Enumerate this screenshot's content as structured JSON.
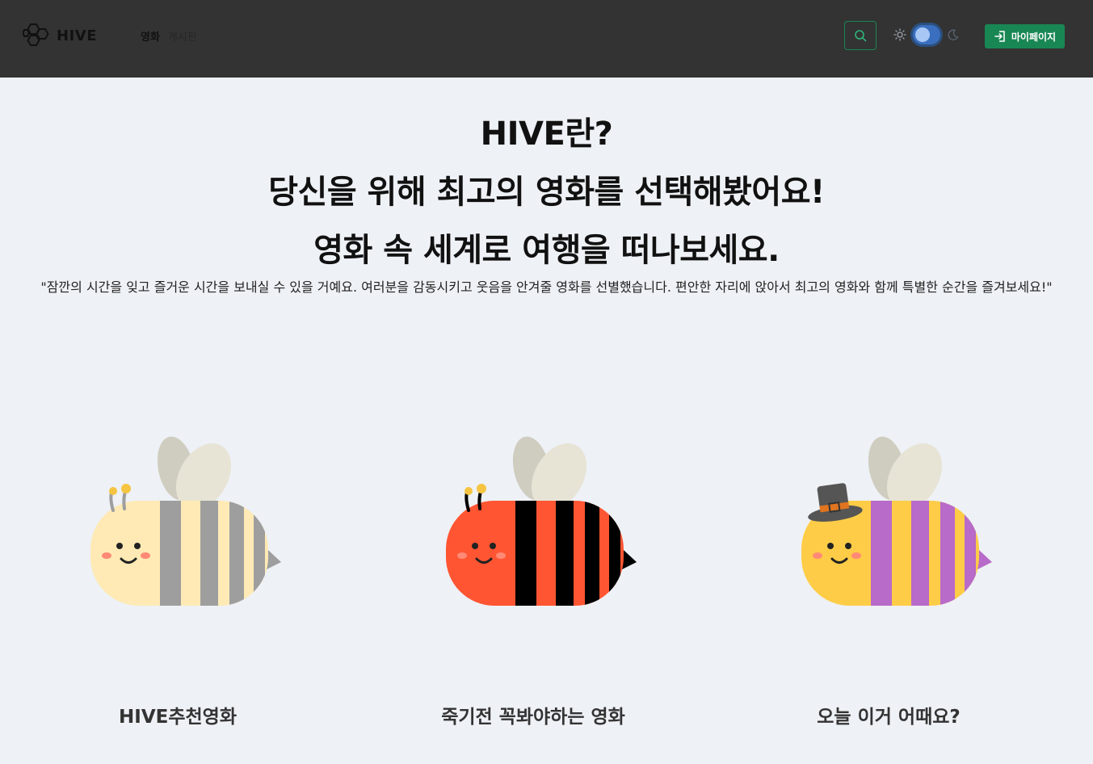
{
  "header": {
    "logo_text": "HIVE",
    "nav": [
      {
        "label": "영화"
      },
      {
        "label": "게시판"
      }
    ],
    "search_icon": "search-icon",
    "theme": {
      "light_icon": "sun-icon",
      "dark_icon": "moon-icon"
    },
    "mypage_label": "마이페이지",
    "mypage_icon": "login-icon"
  },
  "hero": {
    "line1": "HIVE란?",
    "line2": "당신을 위해 최고의 영화를 선택해봤어요!",
    "line3": "영화 속 세계로 여행을 떠나보세요.",
    "description": "\"잠깐의 시간을 잊고 즐거운 시간을 보내실 수 있을 거예요. 여러분을 감동시키고 웃음을 안겨줄 영화를 선별했습니다. 편안한 자리에 앉아서 최고의 영화와 함께 특별한 순간을 즐겨보세요!\""
  },
  "cards": [
    {
      "title": "HIVE추천영화",
      "body_color": "#ffeab5",
      "stripe_color": "#9e9e9e"
    },
    {
      "title": "죽기전 꼭봐야하는 영화",
      "body_color": "#ff5532",
      "stripe_color": "#000000"
    },
    {
      "title": "오늘 이거 어때요?",
      "body_color": "#ffcc47",
      "stripe_color": "#b86bc8"
    }
  ],
  "colors": {
    "navbar": "#333333",
    "accent": "#198754",
    "background": "#eef1f5"
  }
}
